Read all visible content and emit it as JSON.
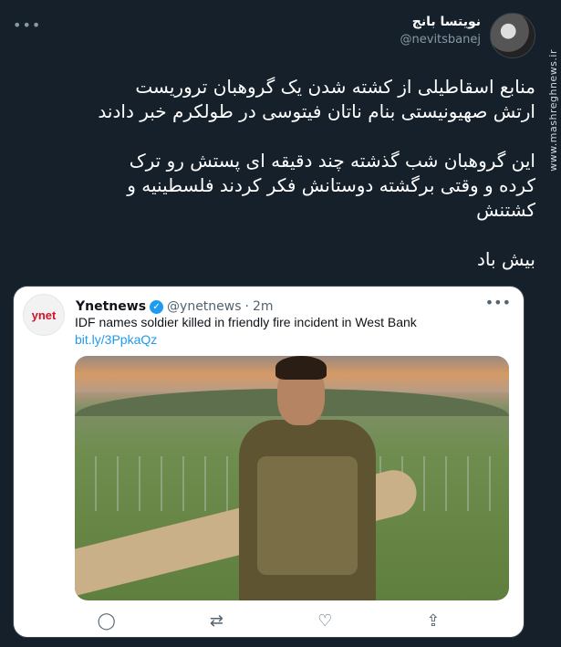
{
  "author": {
    "display_name": "نویتسا بانج",
    "handle": "@nevitsbanej"
  },
  "watermark": "www.mashreghnews.ir",
  "tweet": {
    "paragraphs": [
      "منابع اسقاطیلی از کشته شدن یک گروهبان تروریست\nارتش صهیونیستی بنام ناتان فیتوسی در طولکرم خبر دادند",
      "این گروهبان شب گذشته چند دقیقه ای پستش رو ترک\nکرده و وقتی برگشته دوستانش فکر کردند فلسطینیه و\nکشتنش",
      "بیش باد"
    ]
  },
  "quoted": {
    "logo_text": "ynet",
    "name": "Ynetnews",
    "verified_mark": "✓",
    "handle": "@ynetnews",
    "separator": "·",
    "time": "2m",
    "more": "•••",
    "text": "IDF names soldier killed in friendly fire incident in West Bank",
    "link": "bit.ly/3PpkaQz",
    "actions": {
      "reply": "◯",
      "retweet": "⇄",
      "like": "♡",
      "share": "⇪"
    }
  },
  "more_menu": "•••"
}
